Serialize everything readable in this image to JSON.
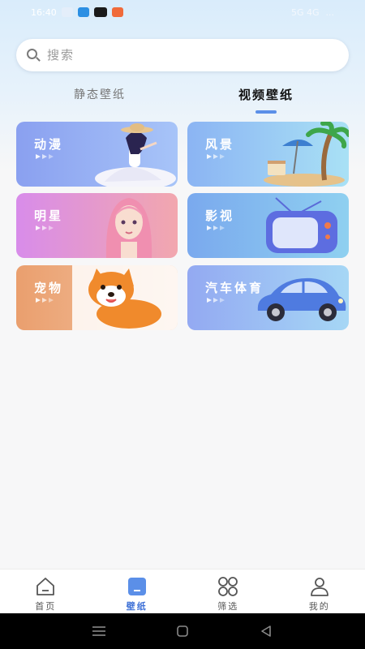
{
  "status_bar": {
    "time": "16:40",
    "right_text": "5G 4G",
    "battery": "..."
  },
  "search": {
    "placeholder": "搜索"
  },
  "tabs": [
    {
      "label": "静态壁纸",
      "active": false
    },
    {
      "label": "视频壁纸",
      "active": true
    }
  ],
  "categories": [
    {
      "label": "动漫",
      "art": "anime-girl-hat"
    },
    {
      "label": "风景",
      "art": "beach-palm-chair"
    },
    {
      "label": "明星",
      "art": "pink-hair-girl"
    },
    {
      "label": "影视",
      "art": "retro-tv"
    },
    {
      "label": "宠物",
      "art": "shiba-dog"
    },
    {
      "label": "汽车体育",
      "art": "blue-beetle-car"
    }
  ],
  "bottom_nav": [
    {
      "label": "首页",
      "icon": "home-icon",
      "active": false
    },
    {
      "label": "壁纸",
      "icon": "wallpaper-icon",
      "active": true
    },
    {
      "label": "筛选",
      "icon": "grid-filter-icon",
      "active": false
    },
    {
      "label": "我的",
      "icon": "profile-icon",
      "active": false
    }
  ],
  "colors": {
    "accent": "#3c6fd6",
    "indicator": "#5b8fe8"
  },
  "system_nav": [
    "menu-icon",
    "home-square-icon",
    "back-icon"
  ]
}
